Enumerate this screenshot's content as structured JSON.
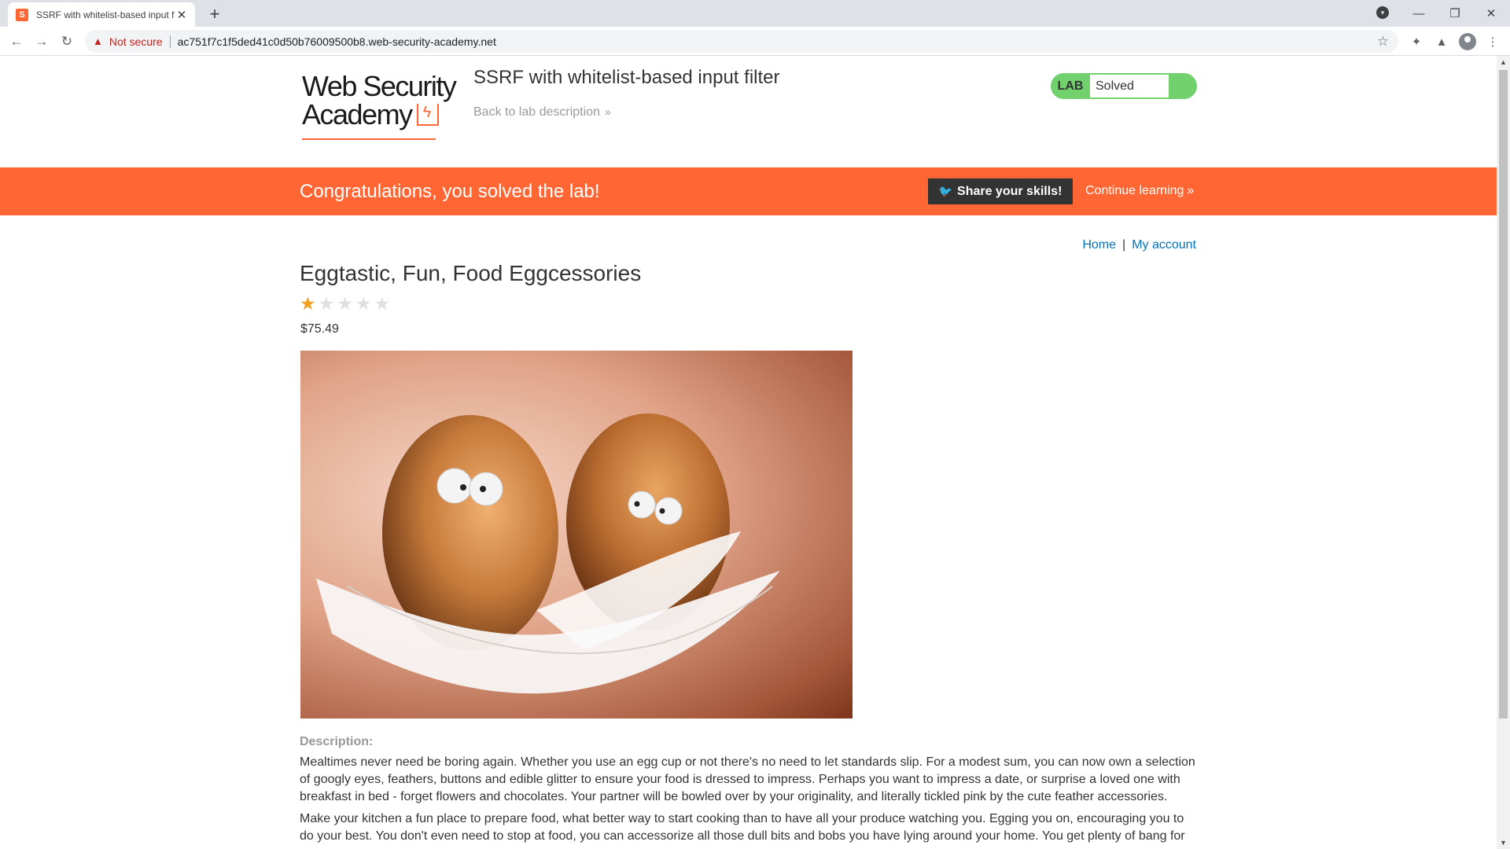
{
  "browser": {
    "tab_title": "SSRF with whitelist-based input f",
    "favicon_text": "S",
    "security_label": "Not secure",
    "url": "ac751f7c1f5ded41c0d50b76009500b8.web-security-academy.net"
  },
  "lab": {
    "logo_line1": "Web Security",
    "logo_line2": "Academy",
    "title": "SSRF with whitelist-based input filter",
    "back_link": "Back to lab description",
    "status_badge": "LAB",
    "status_text": "Solved"
  },
  "banner": {
    "message": "Congratulations, you solved the lab!",
    "share_label": "Share your skills!",
    "continue_label": "Continue learning"
  },
  "nav": {
    "home": "Home",
    "separator": "|",
    "my_account": "My account"
  },
  "product": {
    "title": "Eggtastic, Fun, Food Eggcessories",
    "rating": 1,
    "rating_max": 5,
    "price": "$75.49",
    "description_label": "Description:",
    "description": [
      "Mealtimes never need be boring again. Whether you use an egg cup or not there's no need to let standards slip. For a modest sum, you can now own a selection of googly eyes, feathers, buttons and edible glitter to ensure your food is dressed to impress. Perhaps you want to impress a date, or surprise a loved one with breakfast in bed - forget flowers and chocolates. Your partner will be bowled over by your originality, and literally tickled pink by the cute feather accessories.",
      "Make your kitchen a fun place to prepare food, what better way to start cooking than to have all your produce watching you. Egging you on, encouraging you to do your best. You don't even need to stop at food, you can accessorize all those dull bits and bobs you have lying around your home. You get plenty of bang for"
    ]
  },
  "colors": {
    "accent": "#ff6633",
    "lab_solved": "#70d16d",
    "link": "#0071bc"
  }
}
